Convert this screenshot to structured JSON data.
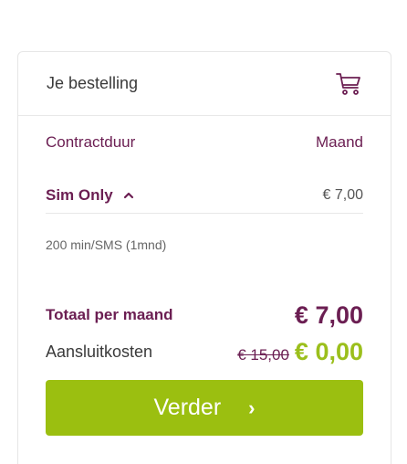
{
  "order": {
    "title": "Je bestelling",
    "contract_label": "Contractduur",
    "contract_value": "Maand",
    "sim_label": "Sim Only",
    "sim_price": "€ 7,00",
    "sim_detail": "200 min/SMS (1mnd)",
    "total_label": "Totaal per maand",
    "total_value": "€ 7,00",
    "aansluit_label": "Aansluitkosten",
    "aansluit_old": "€ 15,00",
    "aansluit_new": "€ 0,00"
  },
  "button": {
    "label": "Verder",
    "arrow": "›"
  },
  "icons": {
    "cart": "cart-icon",
    "chevron": "chevron-up-icon"
  },
  "colors": {
    "primary": "#6b1e52",
    "accent": "#9bbf10"
  }
}
